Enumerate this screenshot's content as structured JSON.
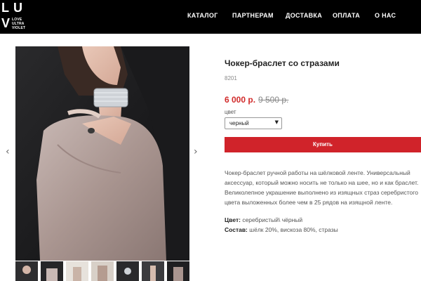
{
  "logo": {
    "letters": [
      "L",
      "U",
      "V"
    ],
    "tagline": "LOVE ULTRA VIOLET"
  },
  "nav": {
    "catalog": "КАТАЛОГ",
    "partners": "ПАРТНЕРАМ",
    "delivery": "ДОСТАВКА",
    "payment": "ОПЛАТА",
    "about": "О НАС"
  },
  "gallery": {
    "thumb_count": 7,
    "prev_icon": "chevron-left-icon",
    "next_icon": "chevron-right-icon"
  },
  "product": {
    "title": "Чокер-браслет со стразами",
    "sku": "8201",
    "price": "6 000 р.",
    "old_price": "9 500 р.",
    "color_label": "цвет",
    "color_selected": "черный",
    "buy_label": "Купить",
    "description": "Чокер-браслет ручной работы на шёлковой ленте. Универсальный аксессуар, который можно носить не только на шее, но и как браслет. Великолепное украшение выполнено из изящных страз серебристого цвета выложенных более чем в 25 рядов на изящной ленте.",
    "specs": {
      "color_label": "Цвет:",
      "color_value": "серебристый\\ чёрный",
      "composition_label": "Состав:",
      "composition_value": "шёлк 20%, вискоза 80%, стразы"
    }
  },
  "colors": {
    "header_bg": "#000000",
    "accent": "#d0232a",
    "price": "#d12a2a"
  }
}
